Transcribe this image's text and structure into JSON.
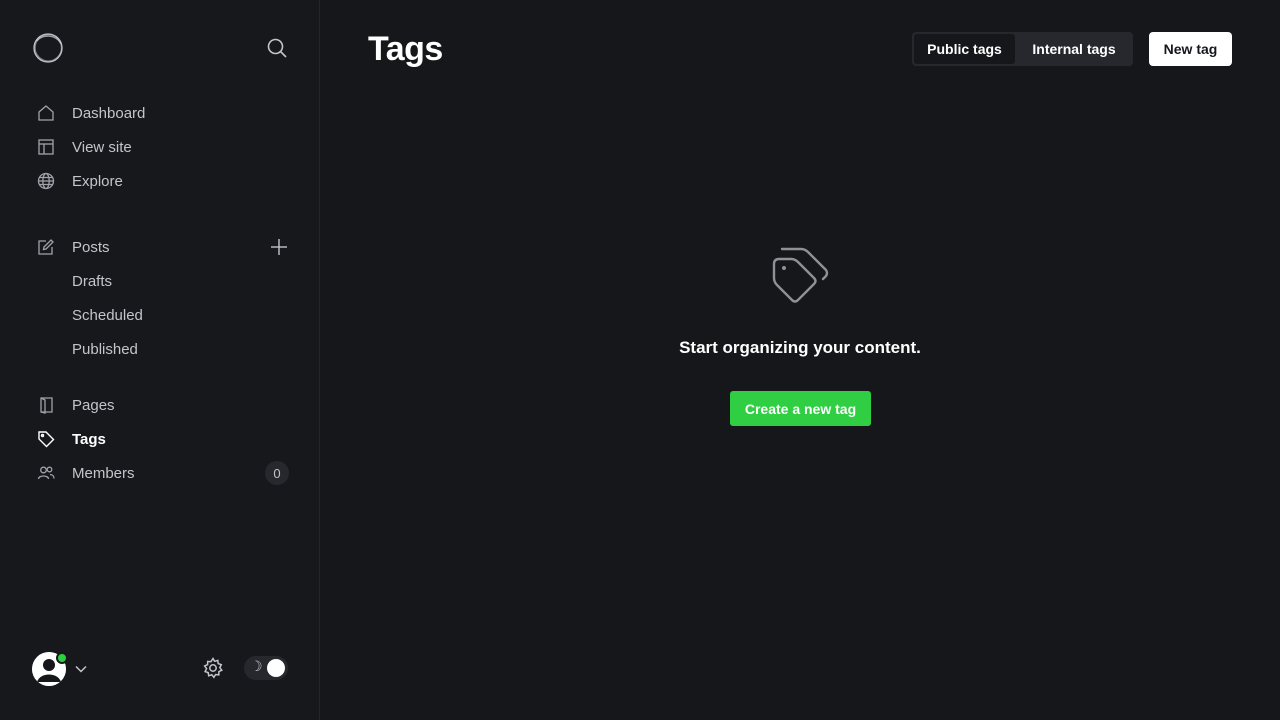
{
  "sidebar": {
    "logo_icon": "ghost-logo-icon",
    "search_icon": "search-icon",
    "primary": [
      {
        "label": "Dashboard",
        "icon": "home-icon"
      },
      {
        "label": "View site",
        "icon": "layout-icon"
      },
      {
        "label": "Explore",
        "icon": "globe-icon"
      }
    ],
    "posts": {
      "label": "Posts",
      "icon": "pencil-icon",
      "add_icon": "plus-icon",
      "children": [
        "Drafts",
        "Scheduled",
        "Published"
      ]
    },
    "secondary": [
      {
        "label": "Pages",
        "icon": "page-icon"
      },
      {
        "label": "Tags",
        "icon": "tag-icon",
        "active": true
      },
      {
        "label": "Members",
        "icon": "users-icon",
        "count": "0"
      }
    ],
    "footer": {
      "avatar_icon": "user-avatar-icon",
      "status_color": "#30cf43",
      "settings_icon": "gear-icon",
      "theme_moon": "☽"
    }
  },
  "main": {
    "title": "Tags",
    "tabs": [
      {
        "label": "Public tags",
        "active": true
      },
      {
        "label": "Internal tags",
        "active": false
      }
    ],
    "new_button": "New tag",
    "empty_state": {
      "icon": "tag-outline-icon",
      "message": "Start organizing your content.",
      "button": "Create a new tag",
      "button_color": "#30cf43"
    }
  }
}
